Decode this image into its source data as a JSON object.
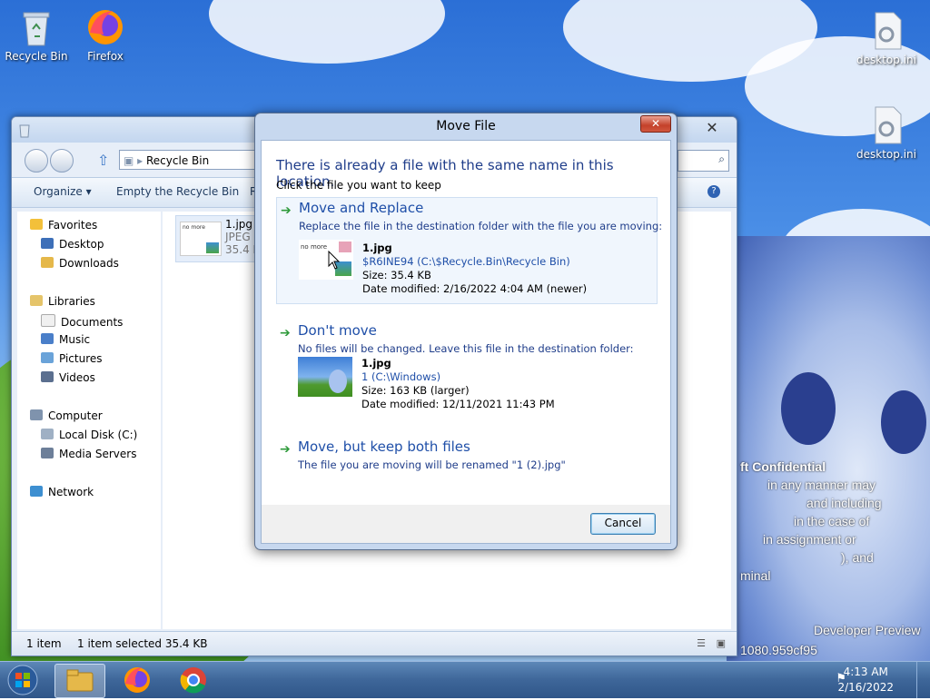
{
  "desktop": {
    "icons": [
      {
        "label": "Recycle Bin"
      },
      {
        "label": "Firefox"
      },
      {
        "label": "desktop.ini"
      },
      {
        "label": "desktop.ini"
      }
    ],
    "watermark_lines": [
      "ft Confidential",
      "in any manner may",
      "and including",
      "in the case of",
      "in assignment or",
      "), and",
      "minal",
      "Developer Preview",
      "1080.959cf95"
    ]
  },
  "explorer": {
    "close_label": "✕",
    "address": "Recycle Bin",
    "commands": {
      "organize": "Organize ▾",
      "empty": "Empty the Recycle Bin",
      "restore": "R"
    },
    "nav": {
      "favorites": "Favorites",
      "desktop": "Desktop",
      "downloads": "Downloads",
      "libraries": "Libraries",
      "documents": "Documents",
      "music": "Music",
      "pictures": "Pictures",
      "videos": "Videos",
      "computer": "Computer",
      "local_disk": "Local Disk (C:)",
      "media_servers": "Media Servers",
      "network": "Network"
    },
    "file": {
      "name": "1.jpg",
      "type": "JPEG",
      "size": "35.4 K",
      "thumb_text": "no more"
    },
    "status": {
      "count": "1 item",
      "selected": "1 item selected  35.4 KB"
    }
  },
  "dialog": {
    "title": "Move File",
    "close_label": "✕",
    "headline": "There is already a file with the same name in this location.",
    "subline": "Click the file you want to keep",
    "options": {
      "replace": {
        "title": "Move and Replace",
        "desc": "Replace the file in the destination folder with the file you are moving:",
        "thumb_text": "no more",
        "file_name": "1.jpg",
        "location": "$R6INE94 (C:\\$Recycle.Bin\\Recycle Bin)",
        "size": "Size: 35.4 KB",
        "modified": "Date modified: 2/16/2022 4:04 AM (newer)"
      },
      "dont_move": {
        "title": "Don't move",
        "desc": "No files will be changed. Leave this file in the destination folder:",
        "file_name": "1.jpg",
        "location": "1 (C:\\Windows)",
        "size": "Size: 163 KB (larger)",
        "modified": "Date modified: 12/11/2021 11:43 PM"
      },
      "keep_both": {
        "title": "Move, but keep both files",
        "desc": "The file you are moving will be renamed \"1 (2).jpg\""
      }
    },
    "cancel_label": "Cancel"
  },
  "taskbar": {
    "time": "4:13 AM",
    "date": "2/16/2022"
  }
}
